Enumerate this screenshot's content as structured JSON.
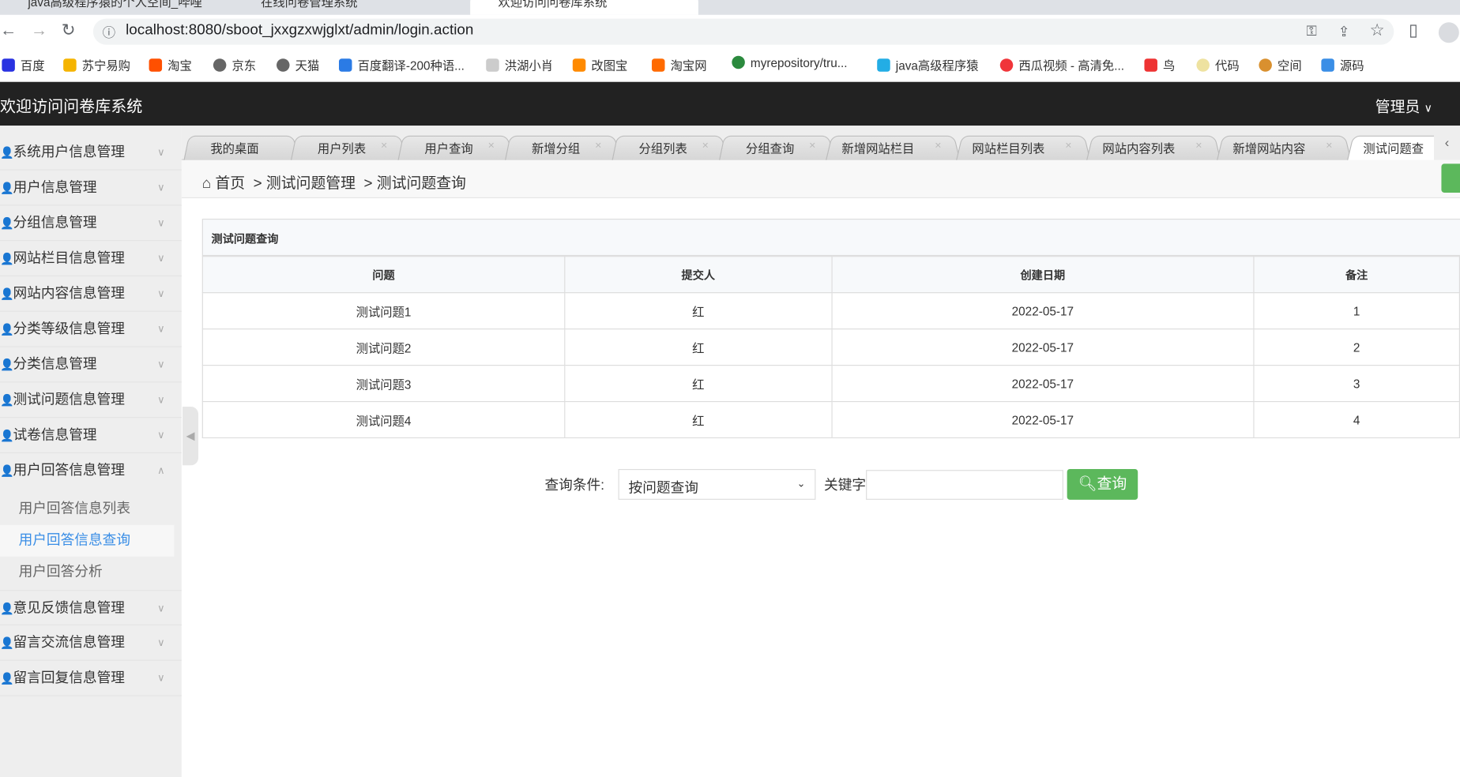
{
  "browser": {
    "tabs": [
      "java高级程序猿的个人空间_哔哩",
      "在线问卷管理系统",
      "欢迎访问问卷库系统"
    ],
    "url": "localhost:8080/sboot_jxxgzxwjglxt/admin/login.action",
    "bookmarks": [
      "百度",
      "苏宁易购",
      "淘宝",
      "京东",
      "天猫",
      "百度翻译-200种语...",
      "洪湖小肖",
      "改图宝",
      "淘宝网",
      "myrepository/tru...",
      "java高级程序猿",
      "西瓜视频 - 高清免...",
      "鸟",
      "代码",
      "空间",
      "源码"
    ]
  },
  "header": {
    "title": "欢迎访问问卷库系统",
    "user": "管理员"
  },
  "sidebar": {
    "items": [
      "系统用户信息管理",
      "用户信息管理",
      "分组信息管理",
      "网站栏目信息管理",
      "网站内容信息管理",
      "分类等级信息管理",
      "分类信息管理",
      "测试问题信息管理",
      "试卷信息管理",
      "用户回答信息管理"
    ],
    "subitems": [
      "用户回答信息列表",
      "用户回答信息查询",
      "用户回答分析"
    ],
    "items_after": [
      "意见反馈信息管理",
      "留言交流信息管理",
      "留言回复信息管理"
    ]
  },
  "tabs": [
    "我的桌面",
    "用户列表",
    "用户查询",
    "新增分组",
    "分组列表",
    "分组查询",
    "新增网站栏目",
    "网站栏目列表",
    "网站内容列表",
    "新增网站内容",
    "测试问题查"
  ],
  "breadcrumb": {
    "home": "首页",
    "sep": ">",
    "section": "测试问题管理",
    "page": "测试问题查询"
  },
  "panel": {
    "title": "测试问题查询",
    "columns": [
      "问题",
      "提交人",
      "创建日期",
      "备注"
    ],
    "rows": [
      [
        "测试问题1",
        "红",
        "2022-05-17",
        "1"
      ],
      [
        "测试问题2",
        "红",
        "2022-05-17",
        "2"
      ],
      [
        "测试问题3",
        "红",
        "2022-05-17",
        "3"
      ],
      [
        "测试问题4",
        "红",
        "2022-05-17",
        "4"
      ]
    ]
  },
  "search": {
    "condition_label": "查询条件:",
    "condition_value": "按问题查询",
    "keyword_label": "关键字",
    "keyword_value": "",
    "button": "查询"
  }
}
